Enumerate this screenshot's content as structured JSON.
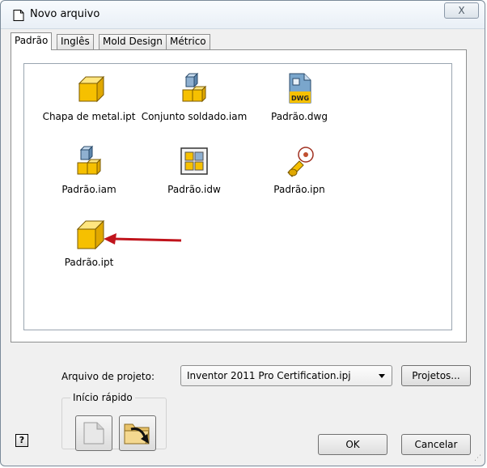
{
  "window": {
    "title": "Novo arquivo",
    "close_label": "X"
  },
  "tabs": [
    {
      "label": "Padrão",
      "active": true
    },
    {
      "label": "Inglês",
      "active": false
    },
    {
      "label": "Mold Design",
      "active": false
    },
    {
      "label": "Métrico",
      "active": false
    }
  ],
  "files": [
    {
      "name": "Chapa de metal.ipt",
      "icon": "sheet-metal-part-icon"
    },
    {
      "name": "Conjunto soldado.iam",
      "icon": "weldment-assembly-icon"
    },
    {
      "name": "Padrão.dwg",
      "icon": "dwg-drawing-icon",
      "badge": "DWG"
    },
    {
      "name": "Padrão.iam",
      "icon": "assembly-icon"
    },
    {
      "name": "Padrão.idw",
      "icon": "idw-drawing-icon"
    },
    {
      "name": "Padrão.ipn",
      "icon": "presentation-icon"
    },
    {
      "name": "Padrão.ipt",
      "icon": "part-icon"
    }
  ],
  "annotation": {
    "color": "#c0141c",
    "target": "Padrão.ipt"
  },
  "project": {
    "label": "Arquivo de projeto:",
    "value": "Inventor 2011 Pro Certification.ipj",
    "projects_button": "Projetos..."
  },
  "quick_launch": {
    "label": "Início rápido",
    "buttons": [
      {
        "icon": "blank-document-icon"
      },
      {
        "icon": "open-folder-arrow-icon"
      }
    ]
  },
  "buttons": {
    "ok": "OK",
    "cancel": "Cancelar",
    "help": "?"
  }
}
